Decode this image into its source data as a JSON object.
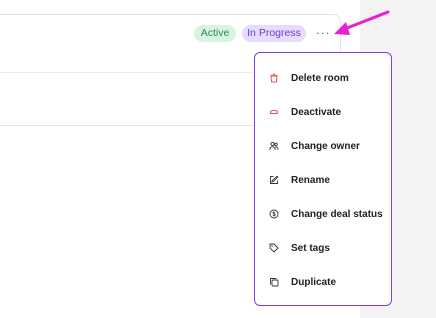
{
  "badges": {
    "active": "Active",
    "in_progress": "In Progress"
  },
  "more_button": {
    "glyph": "···",
    "icon": "more-horizontal-icon"
  },
  "menu": {
    "items": [
      {
        "label": "Delete room",
        "icon": "trash-icon",
        "color": "#e85a5a"
      },
      {
        "label": "Deactivate",
        "icon": "deactivate-icon",
        "color": "#e85a5a"
      },
      {
        "label": "Change owner",
        "icon": "users-icon",
        "color": "#333333"
      },
      {
        "label": "Rename",
        "icon": "pencil-icon",
        "color": "#333333"
      },
      {
        "label": "Change deal status",
        "icon": "dollar-circle-icon",
        "color": "#333333"
      },
      {
        "label": "Set tags",
        "icon": "tag-icon",
        "color": "#333333"
      },
      {
        "label": "Duplicate",
        "icon": "copy-icon",
        "color": "#333333"
      }
    ]
  },
  "colors": {
    "menu_border": "#7b3fe4",
    "pointer_arrow": "#e91fd3",
    "active_badge_bg": "#d9f3e2",
    "progress_badge_bg": "#e6dcfb"
  }
}
